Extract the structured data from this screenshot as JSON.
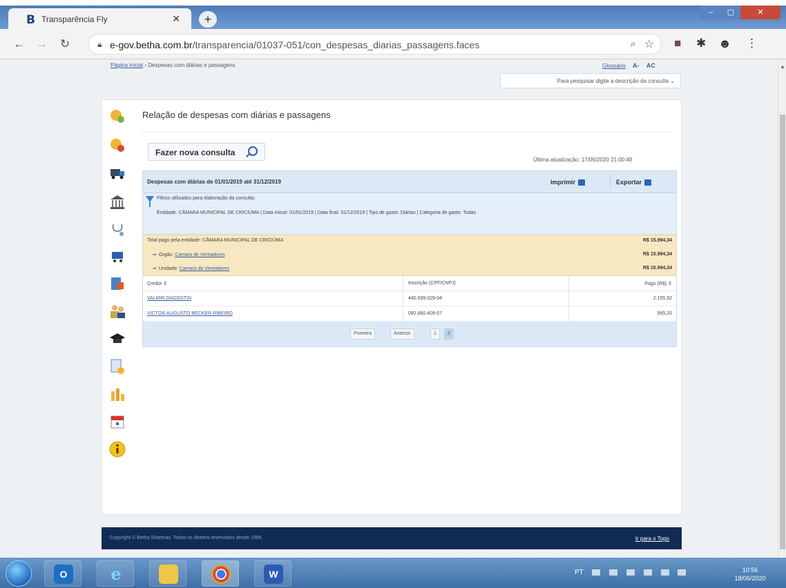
{
  "browser": {
    "tab_title": "Transparência Fly",
    "tab_favicon": "B",
    "url_host": "e-gov.betha.com.br",
    "url_path": "/transparencia/01037-051/con_despesas_diarias_passagens.faces",
    "accent": "#4f7cb7"
  },
  "page": {
    "breadcrumb_home": "Página inicial",
    "breadcrumb_current": "Despesas com diárias e passagens",
    "glossary": "Glossário",
    "font_smaller": "A-",
    "font_larger": "AC",
    "search_placeholder": "Para pesquisar digite a descrição da consulta",
    "title": "Relação de despesas com diárias e passagens",
    "new_query_label": "Fazer nova consulta",
    "last_update": "Última atualização: 17/06/2020 21:00:49"
  },
  "panel": {
    "heading": "Despesas com diárias de 01/01/2019 até 31/12/2019",
    "print_label": "Imprimir",
    "export_label": "Exportar",
    "filters_title": "Filtros utilizados para elaboração da consulta:",
    "filters_value": "Entidade: CÂMARA MUNICIPAL DE CRICIÚMA | Data inicial: 01/01/2019 | Data final: 31/12/2019 | Tipo de gasto: Diárias | Categoria de gasto: Todas",
    "totals": [
      {
        "label": "Total pago pela entidade: CÂMARA MUNICIPAL DE CRICIÚMA",
        "link": "",
        "value": "R$ 15.994,34"
      },
      {
        "label": "Órgão: ",
        "link": "Camara de Vereadores",
        "value": "R$ 15.994,34"
      },
      {
        "label": "Unidade: ",
        "link": "Camara de Vereadores",
        "value": "R$ 15.994,34"
      }
    ],
    "columns": [
      "Credor",
      "Inscrição (CPF/CNPJ)",
      "Pago (R$)"
    ],
    "rows": [
      {
        "credor": "VALMIR DAGOSTIN",
        "inscricao": "440.599.029-04",
        "pago": "2.155,92"
      },
      {
        "credor": "VICTOR AUGUSTO BECKER RIBEIRO",
        "inscricao": "092.660.409-57",
        "pago": "565,20"
      }
    ],
    "pager": [
      "Primeira",
      "Anterior",
      "1",
      "2"
    ]
  },
  "footer": {
    "copyright": "Copyright © Betha Sistemas. Todos os direitos reservados desde 1989.",
    "back_to_top": "Ir para o Topo"
  },
  "taskbar": {
    "language": "PT",
    "time": "10:56",
    "date": "18/06/2020"
  }
}
